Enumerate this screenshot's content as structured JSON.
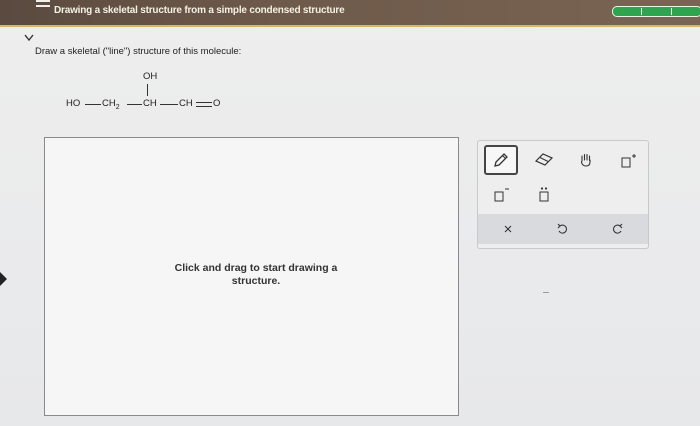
{
  "header": {
    "title": "Drawing a skeletal structure from a simple condensed structure",
    "progress_fraction": 1.0
  },
  "question": {
    "prompt": "Draw a skeletal (\"line\") structure of this molecule:",
    "molecule": {
      "oh": "OH",
      "ho": "HO",
      "ch2": "CH",
      "ch2_sub": "2",
      "ch_mid": "CH",
      "ch_end": "CH",
      "o": "O"
    }
  },
  "canvas": {
    "hint_line1": "Click and drag to start drawing a",
    "hint_line2": "structure."
  },
  "toolbar": {
    "tools": [
      "pencil-icon",
      "eraser-icon",
      "hand-icon",
      "positive-charge-icon",
      "negative-charge-icon",
      "lone-pair-icon"
    ],
    "actions": [
      "clear-icon",
      "undo-icon",
      "redo-icon"
    ]
  },
  "colors": {
    "header_bg": "#6e5a4a",
    "progress": "#2ea44f",
    "accent_line": "#d7b46a"
  }
}
